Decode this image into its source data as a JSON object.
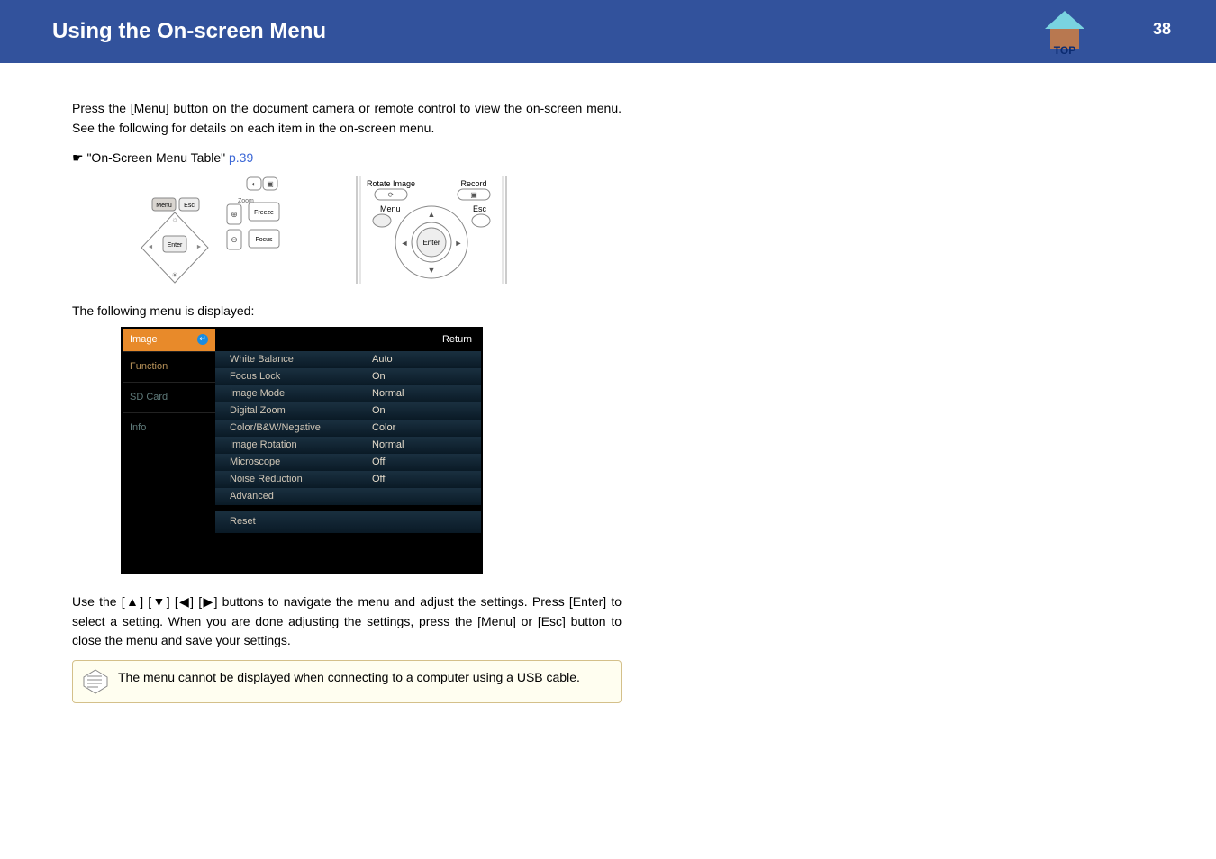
{
  "header": {
    "title": "Using the On-screen Menu",
    "page_number": "38",
    "top_label": "TOP"
  },
  "para1": "Press the [Menu] button on the document camera or remote control to view the on-screen menu. See the following for details on each item in the on-screen menu.",
  "ref": {
    "prefix": "\"On-Screen Menu Table\"",
    "link": "p.39"
  },
  "illus1_labels": {
    "menu": "Menu",
    "esc": "Esc",
    "zoom": "Zoom",
    "enter": "Enter",
    "freeze": "Freeze",
    "focus": "Focus"
  },
  "illus2_labels": {
    "rotate": "Rotate Image",
    "record": "Record",
    "menu": "Menu",
    "esc": "Esc",
    "enter": "Enter"
  },
  "menu_intro": "The following menu is displayed:",
  "menu": {
    "left": [
      "Image",
      "Function",
      "SD Card",
      "Info"
    ],
    "return": "Return",
    "items": [
      {
        "label": "White Balance",
        "value": "Auto"
      },
      {
        "label": "Focus Lock",
        "value": "On"
      },
      {
        "label": "Image Mode",
        "value": "Normal"
      },
      {
        "label": "Digital Zoom",
        "value": "On"
      },
      {
        "label": "Color/B&W/Negative",
        "value": "Color"
      },
      {
        "label": "Image Rotation",
        "value": "Normal"
      },
      {
        "label": "Microscope",
        "value": "Off"
      },
      {
        "label": "Noise Reduction",
        "value": "Off"
      },
      {
        "label": "Advanced",
        "value": ""
      }
    ],
    "reset": "Reset"
  },
  "para2_pre": "Use the [",
  "arrows": {
    "up": "▲",
    "down": "▼",
    "left": "◀",
    "right": "▶"
  },
  "para2_post": "] buttons to navigate the menu and adjust the settings. Press [Enter] to select a setting. When you are done adjusting the settings, press the [Menu] or [Esc] button to close the menu and save your settings.",
  "note": "The menu cannot be displayed when connecting to a computer using a USB cable."
}
